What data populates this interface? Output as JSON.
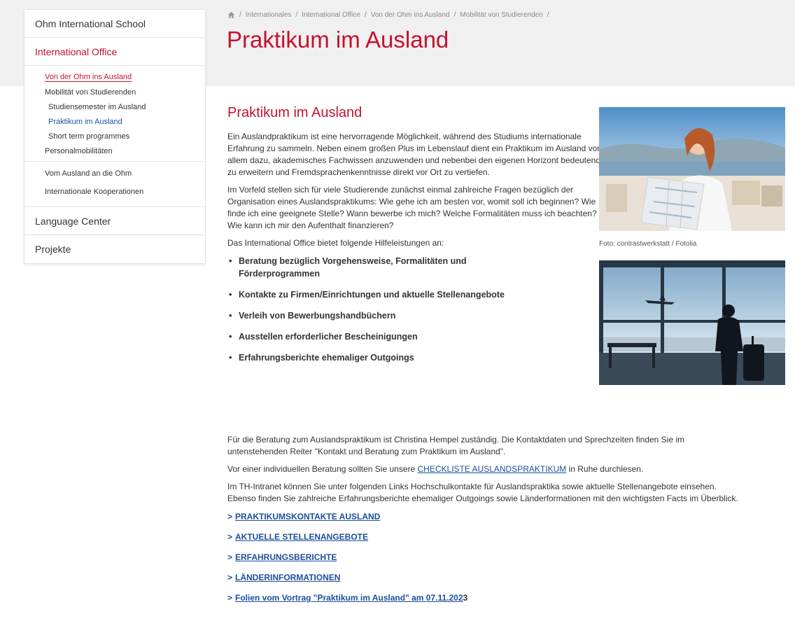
{
  "sidebar": {
    "main_items": [
      "Ohm International School",
      "International Office",
      "Language Center",
      "Projekte"
    ],
    "sub_items": [
      {
        "label": "Von der Ohm ins Ausland",
        "level": 2,
        "state": "active"
      },
      {
        "label": "Mobilität von Studierenden",
        "level": 2,
        "state": "normal"
      },
      {
        "label": "Studiensemester im Ausland",
        "level": 3,
        "state": "normal"
      },
      {
        "label": "Praktikum im Ausland",
        "level": 3,
        "state": "current"
      },
      {
        "label": "Short term programmes",
        "level": 3,
        "state": "normal"
      },
      {
        "label": "Personalmobilitäten",
        "level": 2,
        "state": "normal"
      }
    ],
    "sub_items2": [
      "Vom Ausland an die Ohm",
      "Internationale Kooperationen"
    ]
  },
  "breadcrumb": [
    "Internationales",
    "International Office",
    "Von der Ohm ins Ausland",
    "Mobilität von Studierenden"
  ],
  "page_title": "Praktikum im Ausland",
  "content": {
    "heading": "Praktikum im Ausland",
    "p1": "Ein Auslandpraktikum ist eine hervorragende Möglichkeit, während des Studiums internationale Erfahrung zu sammeln. Neben einem großen Plus im Lebenslauf dient ein Praktikum im Ausland vor allem dazu, akademisches Fachwissen anzuwenden und nebenbei den eigenen Horizont bedeutend zu erweitern und Fremdsprachenkenntnisse direkt vor Ort zu vertiefen.",
    "p2": "Im Vorfeld stellen sich für viele Studierende zunächst einmal zahlreiche Fragen bezüglich der Organisation eines Auslandspraktikums: Wie gehe ich am besten vor, womit soll ich beginnen? Wie finde ich eine geeignete Stelle? Wann bewerbe ich mich? Welche Formalitäten muss ich beachten? Wie kann ich mir den Aufenthalt finanzieren?",
    "p3": "Das International Office bietet folgende Hilfeleistungen an:",
    "bullets": [
      "Beratung bezüglich Vorgehensweise, Formalitäten und Förderprogrammen",
      "Kontakte zu Firmen/Einrichtungen und aktuelle Stellenangebote",
      "Verleih von Bewerbungshandbüchern",
      "Ausstellen erforderlicher Bescheinigungen",
      "Erfahrungsberichte ehemaliger Outgoings"
    ],
    "p4": "Für die Beratung zum Auslandspraktikum ist Christina Hempel zuständig. Die Kontaktdaten und Sprechzeiten finden Sie im untenstehenden Reiter \"Kontakt und Beratung zum Praktikum im Ausland\".",
    "p5_before": "Vor einer individuellen Beratung sollten Sie unsere ",
    "p5_link": "CHECKLISTE AUSLANDSPRAKTIKUM",
    "p5_after": " in Ruhe durchlesen.",
    "p6": "Im TH-Intranet können Sie unter folgenden Links Hochschulkontakte für Auslandspraktika sowie aktuelle Stellenangebote einsehen. Ebenso finden Sie zahlreiche Erfahrungsberichte ehemaliger Outgoings sowie Länderformationen mit den wichtigsten Facts im Überblick.",
    "links": [
      {
        "prefix": ">",
        "label": "PRAKTIKUMSKONTAKTE AUSLAND",
        "tail": ""
      },
      {
        "prefix": ">",
        "label": "AKTUELLE STELLENANGEBOTE",
        "tail": ""
      },
      {
        "prefix": ">",
        "label": "ERFAHRUNGSBERICHTE",
        "tail": ""
      },
      {
        "prefix": ">",
        "label": "LÄNDERINFORMATIONEN",
        "tail": ""
      },
      {
        "prefix": ">",
        "label": "Folien vom Vortrag \"Praktikum im Ausland\" am 07.11.202",
        "tail": "3"
      }
    ]
  },
  "image_caption": "Foto: contrastwerkstatt / Fotolia",
  "colors": {
    "accent_red": "#c4122f",
    "link_blue": "#1b4f9c",
    "header_grey": "#f0f0f0"
  },
  "icons": [
    "home-icon"
  ]
}
